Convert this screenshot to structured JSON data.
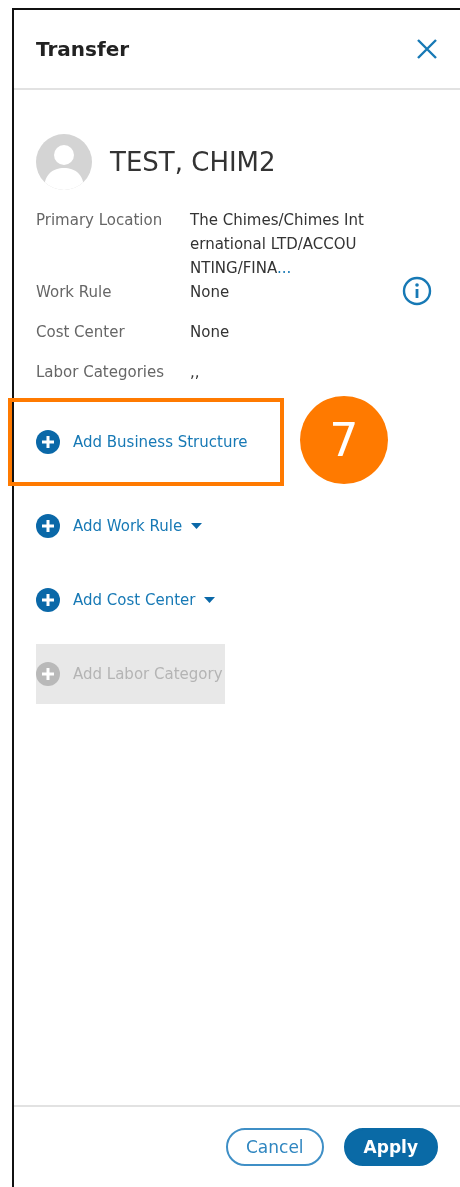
{
  "panel": {
    "title": "Transfer"
  },
  "employee": {
    "name": "TEST, CHIM2"
  },
  "details": [
    {
      "label": "Primary Location",
      "value_lines": [
        "The Chimes/Chimes Int",
        "ernational LTD/ACCOU",
        "NTING/FINA"
      ],
      "more": "...",
      "info": false
    },
    {
      "label": "Work Rule",
      "value_lines": [
        "None"
      ],
      "info": true
    },
    {
      "label": "Cost Center",
      "value_lines": [
        "None"
      ],
      "info": false
    },
    {
      "label": "Labor Categories",
      "value_lines": [
        ",,"
      ],
      "info": false
    }
  ],
  "actions": [
    {
      "label": "Add Business Structure",
      "kind": "plain",
      "disabled": false,
      "highlighted": true
    },
    {
      "label": "Add Work Rule",
      "kind": "dropdown",
      "disabled": false,
      "highlighted": false
    },
    {
      "label": "Add Cost Center",
      "kind": "dropdown",
      "disabled": false,
      "highlighted": false
    },
    {
      "label": "Add Labor Category",
      "kind": "plain",
      "disabled": true,
      "highlighted": false
    }
  ],
  "step_badge": "7",
  "footer": {
    "buttons": [
      {
        "label": "Cancel",
        "kind": "secondary"
      },
      {
        "label": "Apply",
        "kind": "primary"
      }
    ]
  }
}
